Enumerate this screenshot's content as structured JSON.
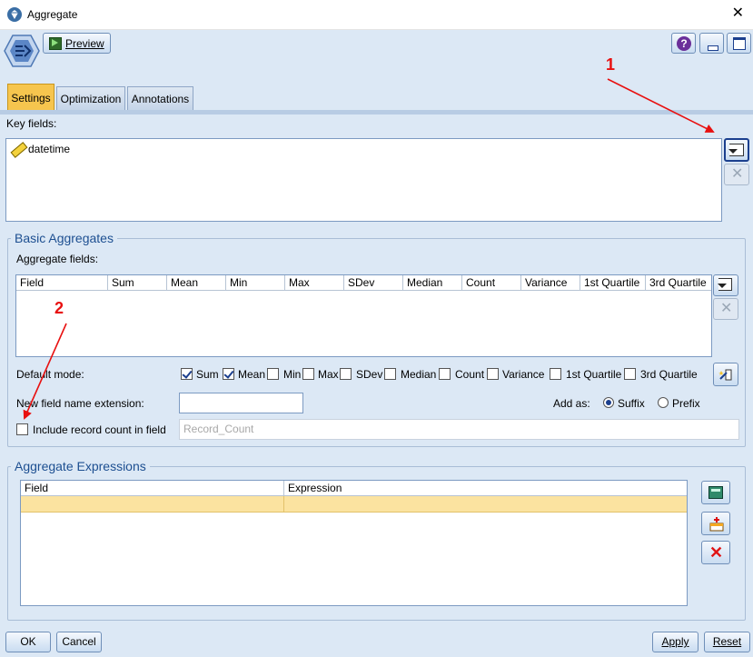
{
  "window": {
    "title": "Aggregate",
    "close_glyph": "✕"
  },
  "toolbar": {
    "preview_label": "Preview"
  },
  "tabs": [
    {
      "label": "Settings",
      "active": true
    },
    {
      "label": "Optimization",
      "active": false
    },
    {
      "label": "Annotations",
      "active": false
    }
  ],
  "key_fields": {
    "label": "Key fields:",
    "items": [
      "datetime"
    ]
  },
  "basic_aggregates": {
    "title": "Basic Aggregates",
    "fields_label": "Aggregate fields:",
    "columns": [
      "Field",
      "Sum",
      "Mean",
      "Min",
      "Max",
      "SDev",
      "Median",
      "Count",
      "Variance",
      "1st Quartile",
      "3rd Quartile"
    ],
    "default_mode_label": "Default mode:",
    "modes": [
      {
        "label": "Sum",
        "checked": true
      },
      {
        "label": "Mean",
        "checked": true
      },
      {
        "label": "Min",
        "checked": false
      },
      {
        "label": "Max",
        "checked": false
      },
      {
        "label": "SDev",
        "checked": false
      },
      {
        "label": "Median",
        "checked": false
      },
      {
        "label": "Count",
        "checked": false
      },
      {
        "label": "Variance",
        "checked": false
      },
      {
        "label": "1st Quartile",
        "checked": false
      },
      {
        "label": "3rd Quartile",
        "checked": false
      }
    ],
    "extension_label": "New field name extension:",
    "extension_value": "",
    "add_as_label": "Add as:",
    "add_as_options": [
      {
        "label": "Suffix",
        "selected": true
      },
      {
        "label": "Prefix",
        "selected": false
      }
    ],
    "record_count_label": "Include record count in field",
    "record_count_checked": false,
    "record_count_field": "Record_Count"
  },
  "aggregate_expressions": {
    "title": "Aggregate Expressions",
    "columns": [
      "Field",
      "Expression"
    ]
  },
  "annotations": [
    {
      "number": "1"
    },
    {
      "number": "2"
    }
  ],
  "footer": {
    "ok": "OK",
    "cancel": "Cancel",
    "apply": "Apply",
    "reset": "Reset"
  },
  "colors": {
    "accent": "#f6c54e",
    "background": "#dce8f5",
    "annotation": "#e81010",
    "selected_row": "#fbe3a0"
  }
}
